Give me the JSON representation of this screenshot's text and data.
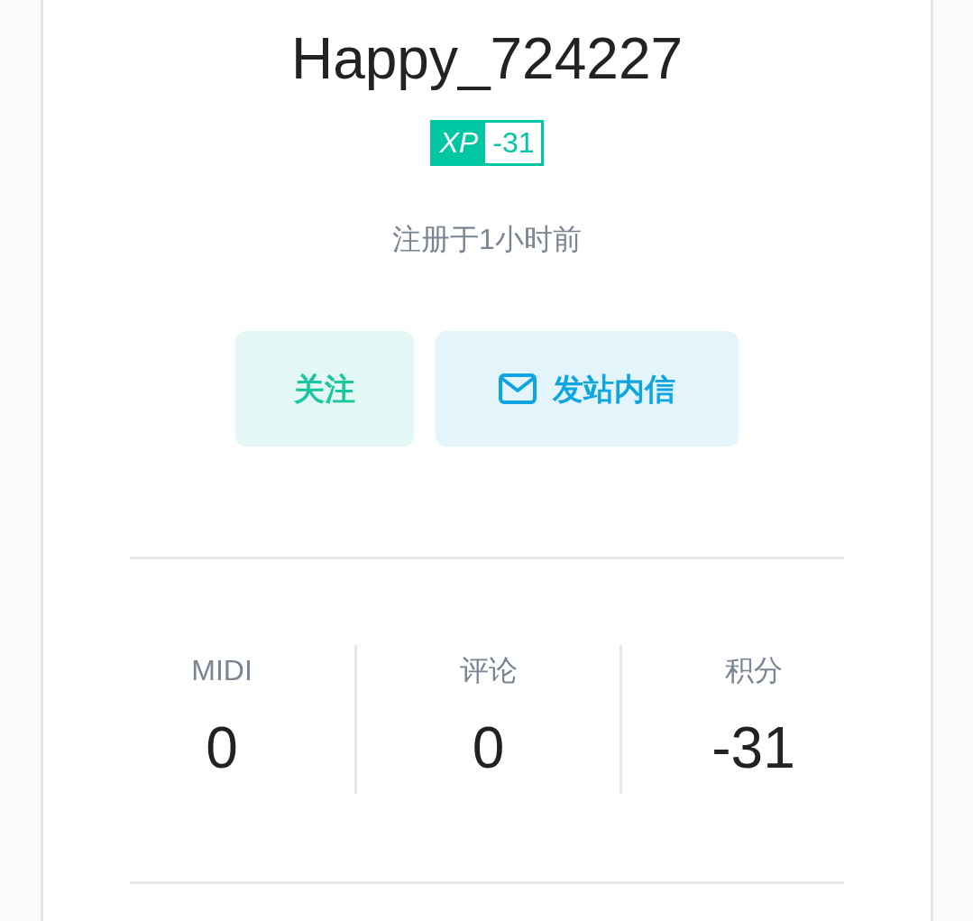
{
  "profile": {
    "username": "Happy_724227",
    "xp_badge": {
      "label": "XP",
      "value": "-31"
    },
    "registered": "注册于1小时前",
    "buttons": [
      {
        "kind": "follow",
        "label": "关注"
      },
      {
        "kind": "message",
        "label": "发站内信"
      }
    ]
  },
  "stats": [
    {
      "label": "MIDI",
      "value": "0"
    },
    {
      "label": "评论",
      "value": "0"
    },
    {
      "label": "积分",
      "value": "-31"
    }
  ]
}
